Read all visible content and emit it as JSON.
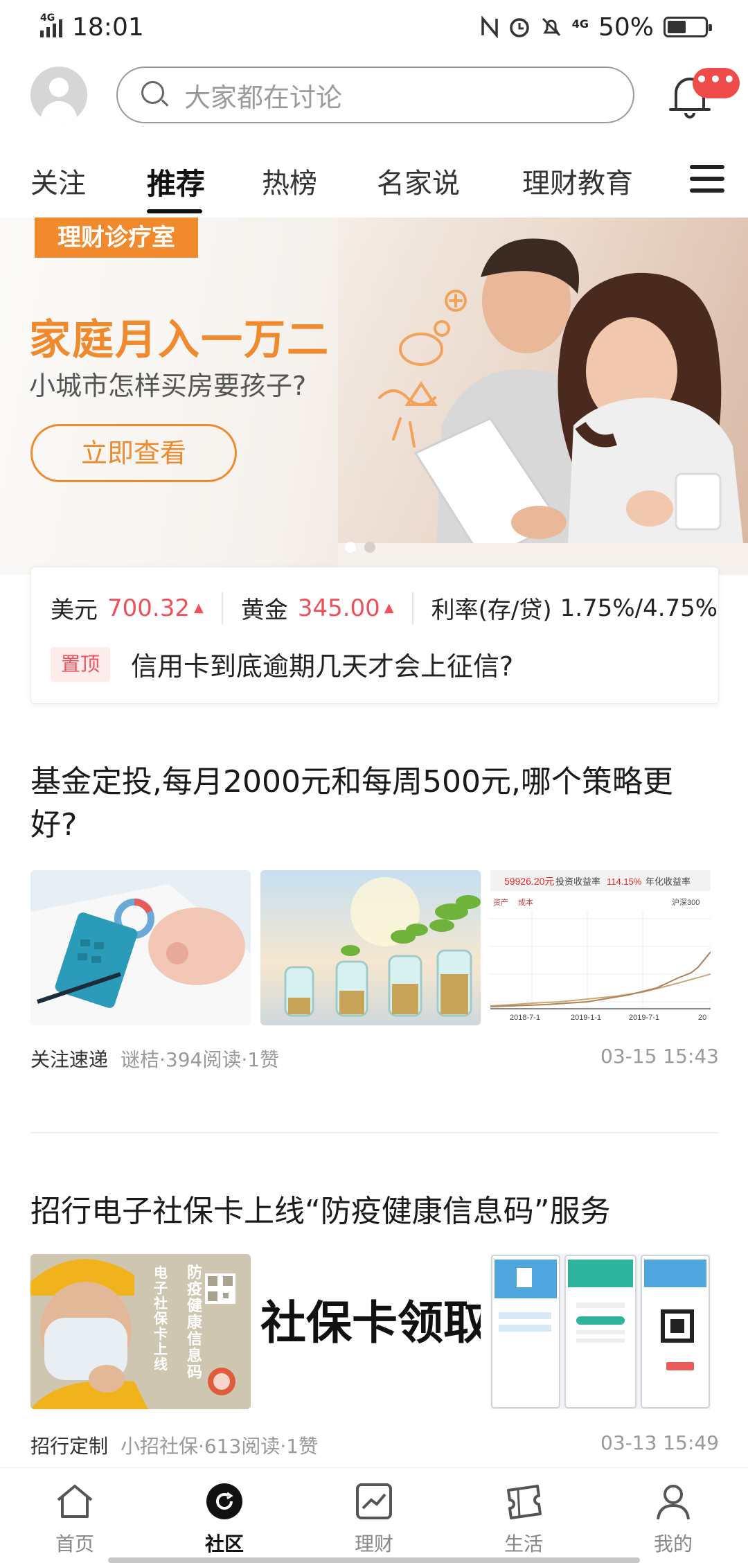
{
  "status_bar": {
    "network": "4G",
    "time": "18:01",
    "battery_network": "4G",
    "battery_percent": "50%",
    "battery_level": 0.5,
    "icons": [
      "nfc-icon",
      "alarm-icon",
      "mute-icon"
    ]
  },
  "header": {
    "search_placeholder": "大家都在讨论",
    "notification_badge": "•••"
  },
  "tabs": [
    {
      "label": "关注"
    },
    {
      "label": "推荐",
      "active": true
    },
    {
      "label": "热榜"
    },
    {
      "label": "名家说"
    },
    {
      "label": "理财教育"
    }
  ],
  "banner": {
    "tag": "理财诊疗室",
    "title": "家庭月入一万二",
    "subtitle": "小城市怎样买房要孩子?",
    "button": "立即查看",
    "active_slide": 1,
    "slide_count": 2
  },
  "market": {
    "usd_label": "美元",
    "usd_value": "700.32",
    "gold_label": "黄金",
    "gold_value": "345.00",
    "rate_label": "利率(存/贷)",
    "rate_value": "1.75%/4.75%",
    "trend_color": "#f0505a"
  },
  "pinned": {
    "tag": "置顶",
    "text": "信用卡到底逾期几天才会上征信?"
  },
  "articles": [
    {
      "title": "基金定投,每月2000元和每周500元,哪个策略更好?",
      "source": "关注速递",
      "info": "谜桔·394阅读·1赞",
      "time": "03-15 15:43",
      "chart_values": {
        "total": "59926.20元",
        "label1": "投资收益率",
        "pct": "114.15%",
        "label2": "年化收益率",
        "legend1": "资产",
        "legend2": "成本",
        "legend3": "沪深300",
        "x1": "2018-7-1",
        "x2": "2019-1-1",
        "x3": "2019-7-1",
        "x4": "20"
      }
    },
    {
      "title": "招行电子社保卡上线“防疫健康信息码”服务",
      "source": "招行定制",
      "info": "小招社保·613阅读·1赞",
      "time": "03-13 15:49",
      "poster_title": "防疫健康信息码",
      "poster_sub": "电子社保卡上线",
      "poster_mid": "社保卡领取入"
    }
  ],
  "bottom_nav": [
    {
      "label": "首页",
      "icon": "home-icon"
    },
    {
      "label": "社区",
      "icon": "community-icon",
      "active": true
    },
    {
      "label": "理财",
      "icon": "wealth-chart-icon"
    },
    {
      "label": "生活",
      "icon": "life-ticket-icon"
    },
    {
      "label": "我的",
      "icon": "profile-icon"
    }
  ],
  "colors": {
    "accent": "#f08a2c",
    "red": "#f0505a",
    "badge": "#f04b4b"
  }
}
